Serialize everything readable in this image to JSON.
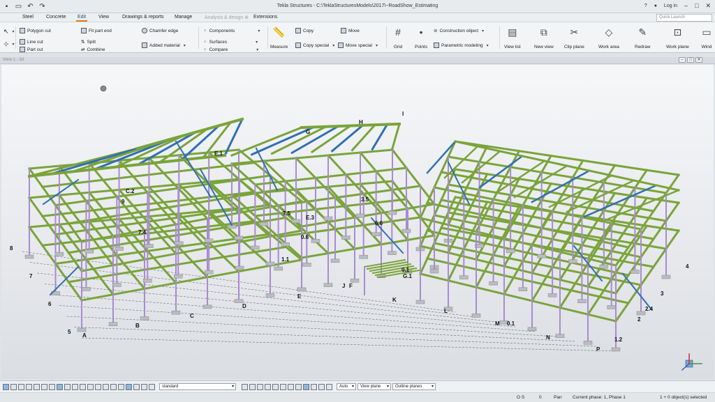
{
  "window": {
    "title": "Tekla Structures - C:\\TeklaStructuresModels\\2017\\~RoadShow_Estimating",
    "help": "?",
    "login": "Log in",
    "quick_launch_placeholder": "Quick Launch"
  },
  "menu": {
    "tabs": [
      "Steel",
      "Concrete",
      "Edit",
      "View",
      "Drawings & reports",
      "Manage",
      "Analysis & design",
      "Extensions"
    ],
    "active": "Edit",
    "disabled": "Analysis & design",
    "disabled_suffix": "⊗"
  },
  "ribbon": {
    "polygon_cut": "Polygon cut",
    "line_cut": "Line cut",
    "part_cut": "Part cut",
    "fit_part_end": "Fit part end",
    "split": "Split",
    "combine": "Combine",
    "chamfer_edge": "Chamfer edge",
    "added_material": "Added material",
    "components": "Components",
    "surfaces": "Surfaces",
    "compare": "Compare",
    "measure": "Measure",
    "copy": "Copy",
    "copy_special": "Copy special",
    "move": "Move",
    "move_special": "Move special",
    "grid": "Grid",
    "points": "Points",
    "construction_object": "Construction object",
    "parametric_modeling": "Parametric modeling",
    "view_list": "View list",
    "new_view": "New view",
    "clip_plane": "Clip plane",
    "work_area": "Work area",
    "redraw": "Redraw",
    "work_plane": "Work plane",
    "windows": "Wind"
  },
  "view": {
    "title": "View 1 - 3d",
    "labels": {
      "A": "A",
      "B": "B",
      "C": "C",
      "D": "D",
      "E": "E",
      "F": "F",
      "G": "G",
      "H": "H",
      "I": "I",
      "J": "J",
      "K": "K",
      "L": "L",
      "M": "M",
      "N": "N",
      "P": "P",
      "n2": "2",
      "n3": "3",
      "n4": "4",
      "n5": "5",
      "n6": "6",
      "n7": "7",
      "n8": "8",
      "n9": "9",
      "c2": "C.2",
      "e3": "E.3",
      "k5": "3.5",
      "i5": "7.5",
      "g6": "6.6",
      "n24": "2.4",
      "n11": "1.1",
      "n01": "0.1",
      "n12": "1.2",
      "m01": "0.1",
      "d6": "0.6",
      "g1": "G.1",
      "a4": "7.4",
      "e1": "E.1"
    }
  },
  "statusbar": {
    "profile": "standard",
    "snap_mode": "Auto",
    "plane": "View plane",
    "outline": "Outline planes",
    "os": "O S",
    "zero": "0",
    "pan": "Pan",
    "phase": "Current phase: 1, Phase 1",
    "selected": "1 + 0 object(s) selected"
  },
  "colors": {
    "beam_green": "#7aa43a",
    "brace_blue": "#2f6fb3",
    "column_purple": "#a98bd0",
    "accent": "#e07a10"
  }
}
